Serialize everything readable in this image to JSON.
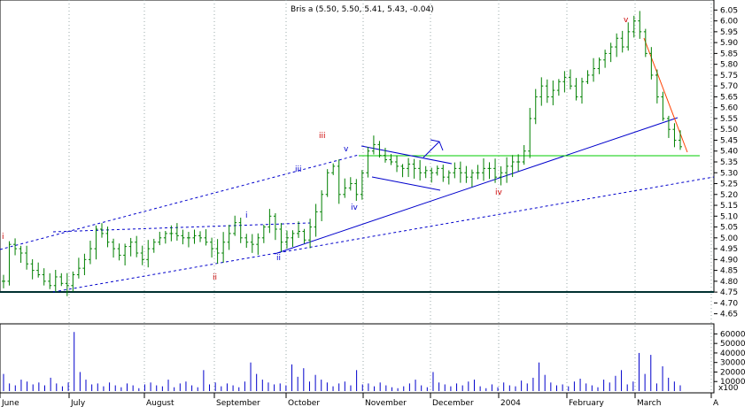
{
  "chart_data": {
    "type": "ohlc",
    "title": "Bris a (5.50, 5.50, 5.41, 5.43, -0.04)",
    "price_axis": {
      "ticks": [
        "6.05",
        "6.00",
        "5.95",
        "5.90",
        "5.85",
        "5.80",
        "5.75",
        "5.70",
        "5.65",
        "5.60",
        "5.55",
        "5.50",
        "5.45",
        "5.40",
        "5.35",
        "5.30",
        "5.25",
        "5.20",
        "5.15",
        "5.10",
        "5.05",
        "5.00",
        "4.95",
        "4.90",
        "4.85",
        "4.80",
        "4.75",
        "4.70",
        "4.65"
      ],
      "ylim": [
        4.62,
        6.08
      ]
    },
    "volume_axis": {
      "ticks": [
        "60000",
        "50000",
        "40000",
        "30000",
        "20000",
        "10000"
      ],
      "unit_label": "x100",
      "ylim": [
        0,
        65000
      ]
    },
    "x_labels": [
      "June",
      "July",
      "August",
      "September",
      "October",
      "November",
      "December",
      "2004",
      "February",
      "March",
      "A"
    ],
    "price_series": [
      4.8,
      4.97,
      4.95,
      4.93,
      4.88,
      4.85,
      4.83,
      4.8,
      4.78,
      4.82,
      4.79,
      4.78,
      4.83,
      4.86,
      4.9,
      4.95,
      5.04,
      5.02,
      4.98,
      4.95,
      4.92,
      4.96,
      4.98,
      4.93,
      4.9,
      4.95,
      4.98,
      5.0,
      5.02,
      5.02,
      5.01,
      5.0,
      5.0,
      5.01,
      5.0,
      4.98,
      4.95,
      4.93,
      4.98,
      5.02,
      5.07,
      5.0,
      4.98,
      4.97,
      5.0,
      5.05,
      5.1,
      5.04,
      4.98,
      5.0,
      5.02,
      5.03,
      4.99,
      5.05,
      5.12,
      5.2,
      5.3,
      5.33,
      5.2,
      5.23,
      5.25,
      5.2,
      5.3,
      5.4,
      5.43,
      5.38,
      5.36,
      5.35,
      5.33,
      5.32,
      5.34,
      5.32,
      5.3,
      5.31,
      5.3,
      5.32,
      5.28,
      5.3,
      5.32,
      5.3,
      5.28,
      5.3,
      5.3,
      5.32,
      5.32,
      5.28,
      5.3,
      5.33,
      5.35,
      5.35,
      5.4,
      5.55,
      5.65,
      5.7,
      5.65,
      5.68,
      5.72,
      5.74,
      5.7,
      5.65,
      5.72,
      5.75,
      5.78,
      5.82,
      5.85,
      5.88,
      5.92,
      5.88,
      5.95,
      6.0,
      5.95,
      5.85,
      5.75,
      5.65,
      5.55,
      5.5,
      5.45,
      5.42
    ],
    "volume_series": [
      18000,
      8000,
      6000,
      12000,
      10000,
      7000,
      9000,
      6000,
      14000,
      8000,
      5000,
      9000,
      62000,
      20000,
      12000,
      7000,
      8000,
      5000,
      9000,
      6000,
      4000,
      8000,
      6000,
      3000,
      7000,
      9000,
      6000,
      5000,
      12000,
      4000,
      8000,
      10000,
      6000,
      4000,
      22000,
      7000,
      9000,
      5000,
      8000,
      6000,
      4000,
      10000,
      30000,
      18000,
      12000,
      9000,
      7000,
      8000,
      6000,
      28000,
      15000,
      24000,
      10000,
      17000,
      12000,
      9000,
      5000,
      8000,
      10000,
      6000,
      22000,
      7000,
      8000,
      5000,
      9000,
      6000,
      4000,
      3000,
      5000,
      8000,
      12000,
      6000,
      4000,
      20000,
      9000,
      7000,
      5000,
      8000,
      6000,
      10000,
      12000,
      5000,
      3000,
      7000,
      4000,
      9000,
      6000,
      5000,
      11000,
      8000,
      14000,
      30000,
      17000,
      9000,
      6000,
      7000,
      5000,
      10000,
      13000,
      8000,
      6000,
      4000,
      12000,
      9000,
      16000,
      22000,
      7000,
      10000,
      40000,
      18000,
      38000,
      8000,
      26000,
      14000,
      10000,
      6000
    ],
    "wave_labels": [
      "i",
      "ii",
      "i",
      "ii",
      "iii",
      "iii",
      "iv",
      "v",
      "iv",
      "v"
    ],
    "colors": {
      "bars": "#008000",
      "volume": "#0000cc",
      "trendlines": "#0000cc",
      "support": "#00cc00",
      "downtrend": "#ff4000",
      "wave_blue": "#0000cc",
      "wave_red": "#cc0000"
    },
    "grid": true,
    "legend": "none"
  }
}
